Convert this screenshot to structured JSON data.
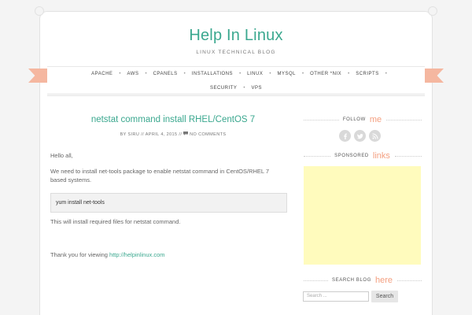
{
  "header": {
    "title": "Help In Linux",
    "tagline": "LINUX TECHNICAL BLOG"
  },
  "nav": {
    "row1": [
      "APACHE",
      "AWS",
      "CPANELS",
      "INSTALLATIONS",
      "LINUX",
      "MYSQL",
      "OTHER *NIX",
      "SCRIPTS"
    ],
    "row2": [
      "SECURITY",
      "VPS"
    ]
  },
  "post": {
    "title": "netstat command install RHEL/CentOS 7",
    "meta_by": "BY SIRU",
    "meta_sep": "//",
    "meta_date": "APRIL 4, 2015",
    "meta_comments": "NO COMMENTS",
    "greeting": "Hello all,",
    "body1": "We need to install net-tools package to enable netstat command in CentOS/RHEL 7 based systems.",
    "code": "yum install net-tools",
    "body2": "This will install required files for netstat command.",
    "thanks": "Thank you for viewing",
    "link": "http://helpinlinux.com"
  },
  "sidebar": {
    "follow_label": "FOLLOW",
    "follow_accent": "me",
    "sponsored_label": "SPONSORED",
    "sponsored_accent": "links",
    "search_label": "SEARCH BLOG",
    "search_accent": "here",
    "search_placeholder": "Search ...",
    "search_button": "Search",
    "social_icons": [
      "facebook-icon",
      "twitter-icon",
      "rss-icon"
    ]
  },
  "colors": {
    "accent_green": "#3ba88f",
    "accent_salmon": "#f4a081",
    "ribbon": "#f5b7a0",
    "sponsor_bg": "#fffbbd"
  }
}
